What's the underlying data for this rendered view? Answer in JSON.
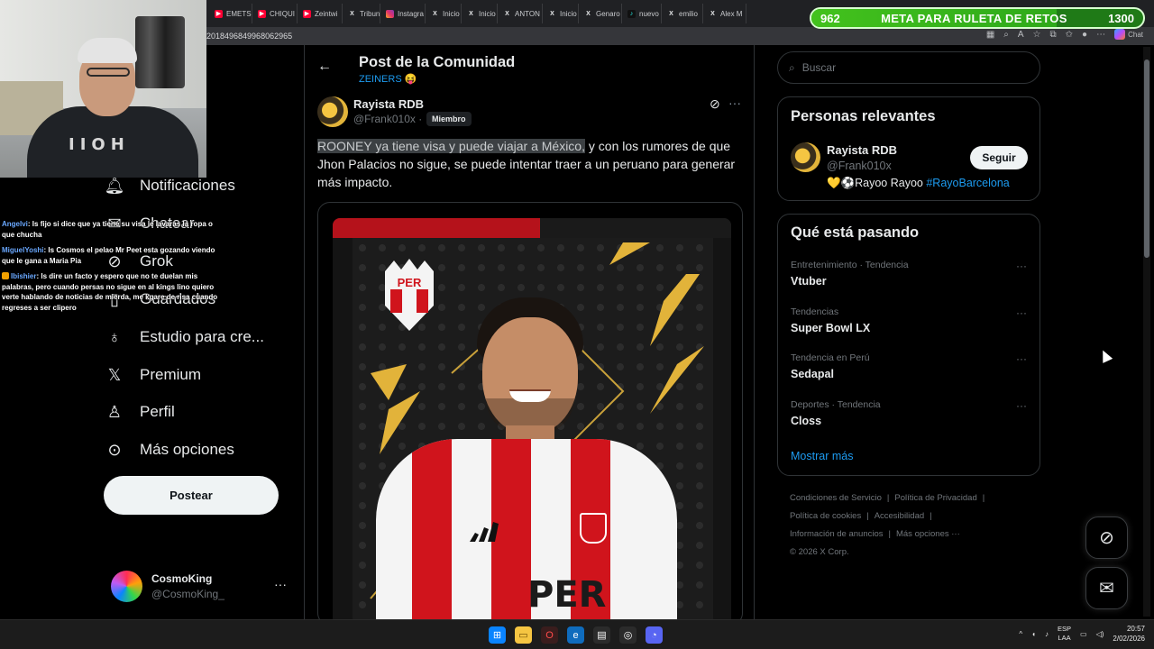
{
  "browser": {
    "tabs": [
      {
        "icon": "youtube-icon",
        "label": "EMETS"
      },
      {
        "icon": "youtube-icon",
        "label": "CHIQUI"
      },
      {
        "icon": "youtube-icon",
        "label": "Zeintwi"
      },
      {
        "icon": "x-icon",
        "label": "Tribuna"
      },
      {
        "icon": "instagram-icon",
        "label": "Instagra"
      },
      {
        "icon": "x-icon",
        "label": "Inicio /"
      },
      {
        "icon": "x-icon",
        "label": "Inicio /"
      },
      {
        "icon": "x-icon",
        "label": "ANTON"
      },
      {
        "icon": "x-icon",
        "label": "Inicio /"
      },
      {
        "icon": "x-icon",
        "label": "Genaro"
      },
      {
        "icon": "tiktok-icon",
        "label": "nuevo"
      },
      {
        "icon": "x-icon",
        "label": "emilio"
      },
      {
        "icon": "x-icon",
        "label": "Alex M"
      }
    ],
    "url": "2018496849968062965",
    "chat_label": "Chat"
  },
  "goal": {
    "current": "962",
    "title": "META PARA RULETA DE RETOS",
    "target": "1300",
    "progress": 0.74,
    "color_fill": "#43c21d",
    "color_border": "#d8ffd0"
  },
  "stream_chat": [
    {
      "user": "Angelvi",
      "text": ": Is fijo si dice que ya tiene su visa le lavaras la ropa o que chucha",
      "badge": false
    },
    {
      "user": "MiguelYoshi",
      "text": ": Is Cosmos el pelao Mr Peet esta gozando viendo que le gana a Maria Pia",
      "badge": false
    },
    {
      "user": "Ibishier",
      "text": ": Is dire un facto y espero que no te duelan mis palabras, pero cuando persas no sigue en al kings lino quiero verte hablando de noticias de mierda, me kgare de risa cuando regreses a ser clipero",
      "badge": true
    }
  ],
  "nav": {
    "items": [
      {
        "icon": "bell-icon",
        "label": "Notificaciones"
      },
      {
        "icon": "mail-icon",
        "label": "Chatear"
      },
      {
        "icon": "grok-icon",
        "label": "Grok"
      },
      {
        "icon": "bookmark-icon",
        "label": "Guardados"
      },
      {
        "icon": "flask-icon",
        "label": "Estudio para cre..."
      },
      {
        "icon": "x-logo-icon",
        "label": "Premium"
      },
      {
        "icon": "person-icon",
        "label": "Perfil"
      },
      {
        "icon": "more-circle-icon",
        "label": "Más opciones"
      }
    ],
    "post_button": "Postear",
    "account": {
      "name": "CosmoKing",
      "handle": "@CosmoKing_"
    }
  },
  "post": {
    "header_title": "Post de la Comunidad",
    "community": "ZEINERS 😝",
    "author": "Rayista RDB",
    "handle": "@Frank010x ·",
    "badge": "Miembro",
    "text_highlighted": "ROONEY ya tiene visa y puede viajar a México,",
    "text_rest": " y con los rumores de que Jhon Palacios no sigue, se puede intentar traer a un peruano para generar más impacto.",
    "image": {
      "crest_text": "PER",
      "jersey_text": "PER"
    }
  },
  "sidebar": {
    "search_placeholder": "Buscar",
    "relevant": {
      "title": "Personas relevantes",
      "name": "Rayista RDB",
      "handle": "@Frank010x",
      "follow": "Seguir",
      "bio_prefix": "💛⚽Rayoo Rayoo ",
      "bio_tag": "#RayoBarcelona"
    },
    "trends": {
      "title": "Qué está pasando",
      "items": [
        {
          "context": "Entretenimiento · Tendencia",
          "name": "Vtuber"
        },
        {
          "context": "Tendencias",
          "name": "Super Bowl LX"
        },
        {
          "context": "Tendencia en Perú",
          "name": "Sedapal"
        },
        {
          "context": "Deportes · Tendencia",
          "name": "Closs"
        }
      ],
      "show_more": "Mostrar más"
    },
    "footer": [
      "Condiciones de Servicio",
      "Política de Privacidad",
      "Política de cookies",
      "Accesibilidad",
      "Información de anuncios",
      "Más opciones ···",
      "© 2026 X Corp."
    ]
  },
  "taskbar": {
    "lang1": "ESP",
    "lang2": "LAA",
    "time": "20:57",
    "date": "2/02/2026"
  },
  "colors": {
    "accent": "#1d9bf0",
    "background": "#000000",
    "text": "#e7e9ea",
    "muted": "#71767b"
  }
}
